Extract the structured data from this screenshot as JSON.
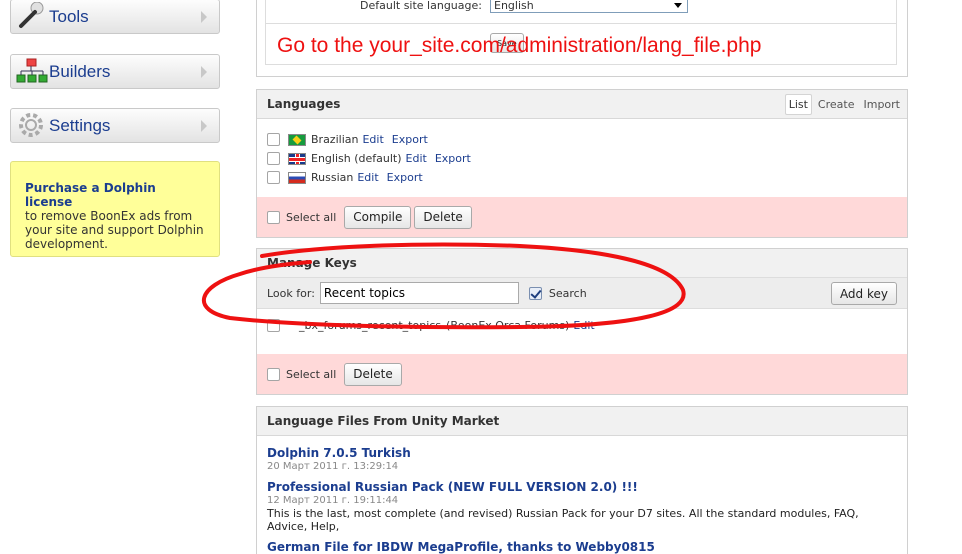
{
  "sidebar": {
    "items": [
      {
        "label": "Tools",
        "icon": "tools-icon"
      },
      {
        "label": "Builders",
        "icon": "builders-icon"
      },
      {
        "label": "Settings",
        "icon": "gear-icon"
      }
    ],
    "promo": {
      "link": "Purchase a Dolphin license",
      "text": "to remove BoonEx ads from your site and support Dolphin development."
    }
  },
  "settings_panel": {
    "label": "Default site language:",
    "selected": "English",
    "save_label": "Save"
  },
  "annotation": "Go to the your_site.com/administration/lang_file.php",
  "languages": {
    "title": "Languages",
    "tabs": [
      "List",
      "Create",
      "Import"
    ],
    "rows": [
      {
        "name": "Brazilian",
        "flag": "br",
        "edit": "Edit",
        "export": "Export"
      },
      {
        "name": "English (default)",
        "flag": "gb",
        "edit": "Edit",
        "export": "Export"
      },
      {
        "name": "Russian",
        "flag": "ru",
        "edit": "Edit",
        "export": "Export"
      }
    ],
    "select_all": "Select all",
    "compile_label": "Compile",
    "delete_label": "Delete"
  },
  "manage_keys": {
    "title": "Manage Keys",
    "look_for_label": "Look for:",
    "search_value": "Recent topics",
    "search_label": "Search",
    "add_key_label": "Add key",
    "result_key": "_bx_forums_recent_topics",
    "result_module": "(BoonEx Orca Forums)",
    "result_edit": "Edit",
    "select_all": "Select all",
    "delete_label": "Delete"
  },
  "market": {
    "title": "Language Files From Unity Market",
    "items": [
      {
        "title": "Dolphin 7.0.5 Turkish",
        "date": "20 Март 2011 г. 13:29:14",
        "desc": ""
      },
      {
        "title": "Professional Russian Pack (NEW FULL VERSION 2.0) !!!",
        "date": "12 Март 2011 г. 19:11:44",
        "desc": "This is the last, most complete (and revised) Russian Pack for your D7 sites. All the standard modules, FAQ, Advice, Help,"
      },
      {
        "title": "German File for IBDW MegaProfile, thanks to Webby0815",
        "date": "",
        "desc": ""
      }
    ]
  },
  "colors": {
    "annotation": "#ee1111",
    "link": "#1b3d8f",
    "danger_bar": "#ffd9d9",
    "promo": "#ffff99"
  }
}
